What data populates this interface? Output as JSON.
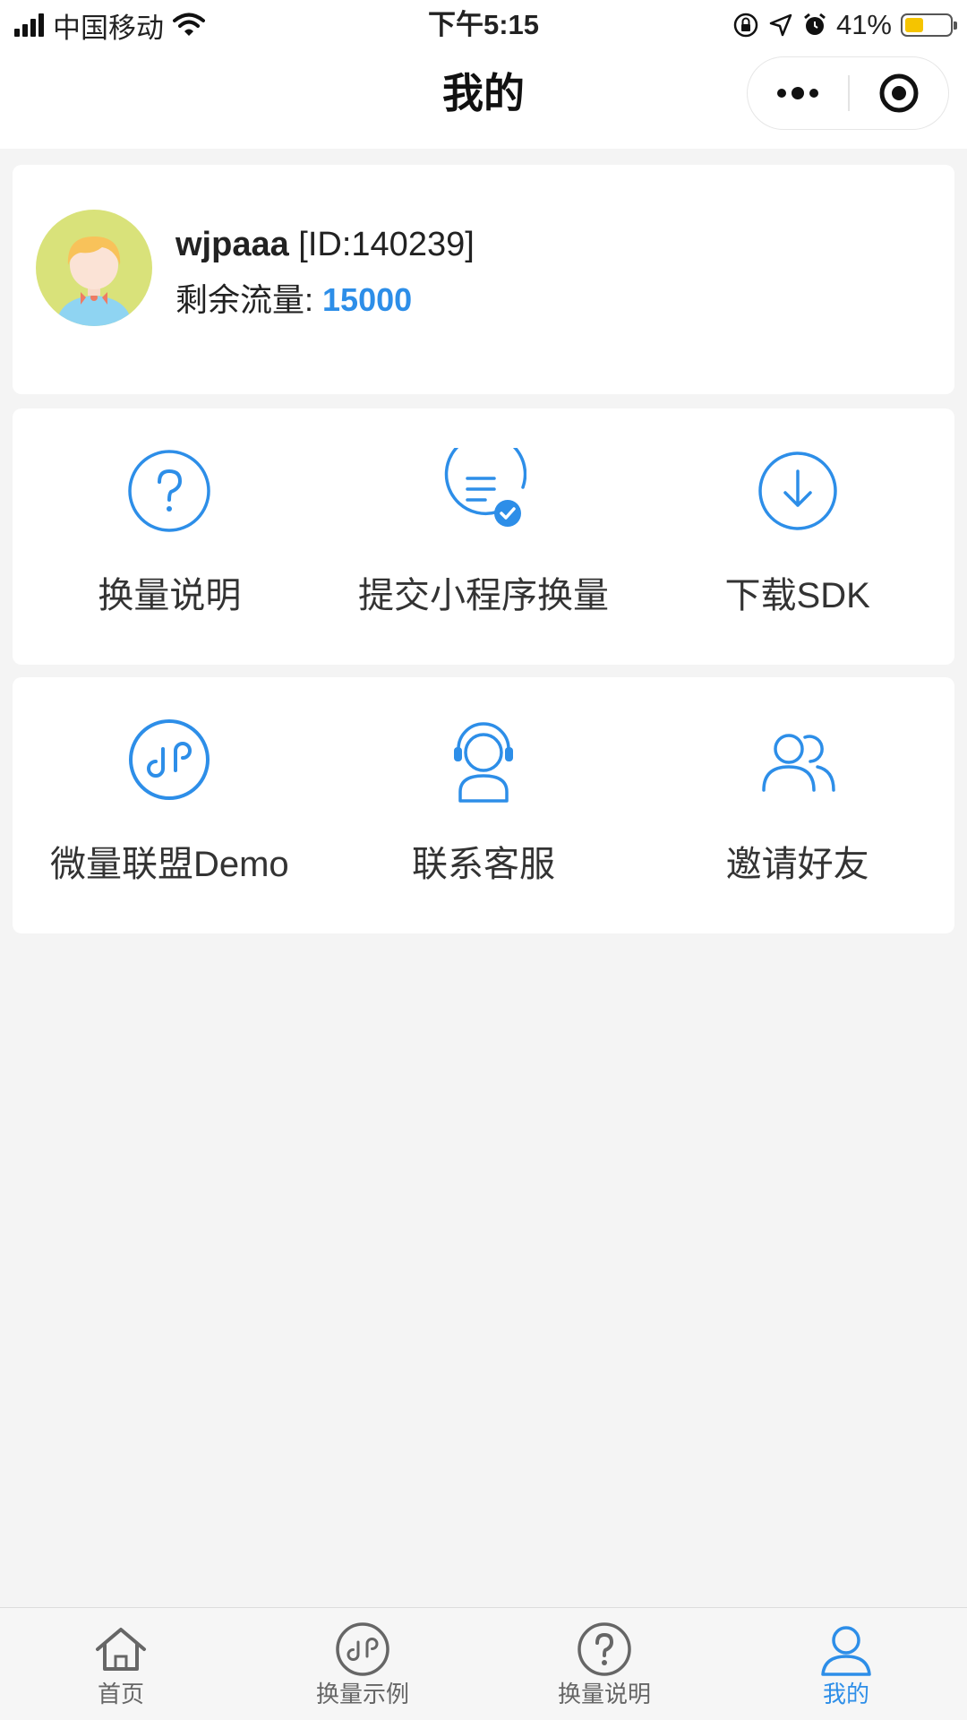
{
  "status_bar": {
    "carrier": "中国移动",
    "time": "下午5:15",
    "battery": "41%",
    "battery_level": 0.41,
    "icons": [
      "signal-icon",
      "wifi-icon",
      "rotation-lock-icon",
      "location-icon",
      "alarm-icon",
      "battery-icon"
    ]
  },
  "nav": {
    "title": "我的",
    "capsule_icons": [
      "more-icon",
      "close-target-icon"
    ]
  },
  "profile": {
    "name": "wjpaaa",
    "id_text": "[ID:140239]",
    "flow_label": "剩余流量:",
    "flow_value": "15000"
  },
  "menu_row1": [
    {
      "label": "换量说明",
      "icon": "question-circle-icon"
    },
    {
      "label": "提交小程序换量",
      "icon": "document-check-icon"
    },
    {
      "label": "下载SDK",
      "icon": "download-circle-icon"
    }
  ],
  "menu_row2": [
    {
      "label": "微量联盟Demo",
      "icon": "mini-program-icon"
    },
    {
      "label": "联系客服",
      "icon": "headset-user-icon"
    },
    {
      "label": "邀请好友",
      "icon": "users-icon"
    }
  ],
  "tabs": [
    {
      "label": "首页",
      "icon": "home-icon",
      "active": false
    },
    {
      "label": "换量示例",
      "icon": "mini-program-icon",
      "active": false
    },
    {
      "label": "换量说明",
      "icon": "question-circle-icon",
      "active": false
    },
    {
      "label": "我的",
      "icon": "user-icon",
      "active": true
    }
  ],
  "colors": {
    "accent": "#2d8ee8",
    "background": "#f4f4f4",
    "card": "#ffffff",
    "tab_inactive": "#666666"
  }
}
